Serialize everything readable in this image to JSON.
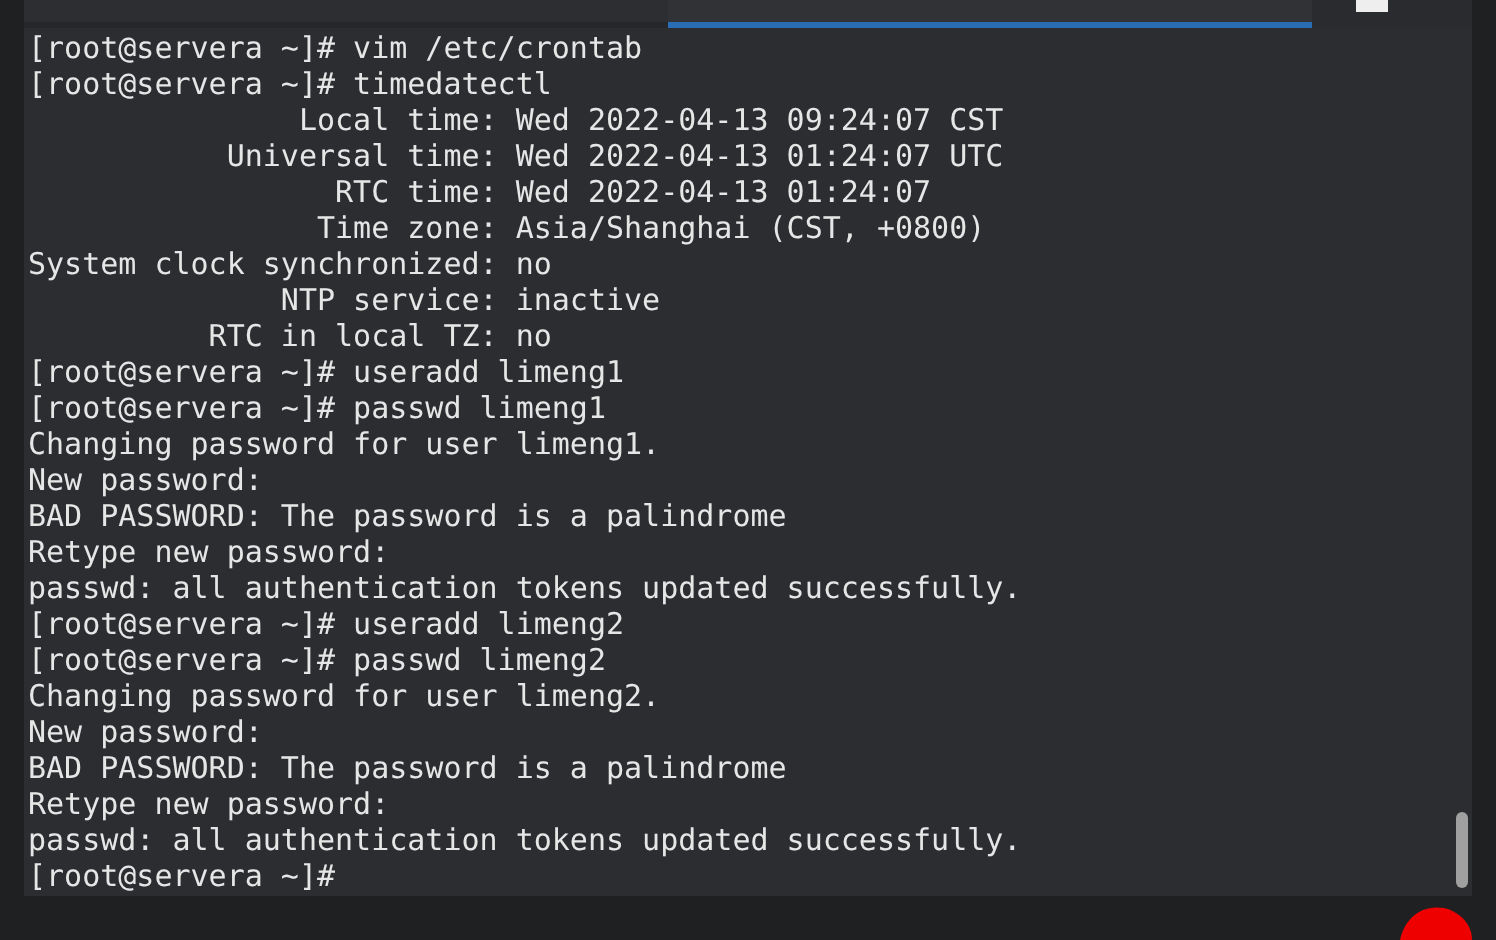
{
  "tabs": [
    {
      "selected": false
    },
    {
      "selected": true
    }
  ],
  "terminal": {
    "lines": [
      "[root@servera ~]# vim /etc/crontab",
      "[root@servera ~]# timedatectl",
      "               Local time: Wed 2022-04-13 09:24:07 CST",
      "           Universal time: Wed 2022-04-13 01:24:07 UTC",
      "                 RTC time: Wed 2022-04-13 01:24:07",
      "                Time zone: Asia/Shanghai (CST, +0800)",
      "System clock synchronized: no",
      "              NTP service: inactive",
      "          RTC in local TZ: no",
      "[root@servera ~]# useradd limeng1",
      "[root@servera ~]# passwd limeng1",
      "Changing password for user limeng1.",
      "New password:",
      "BAD PASSWORD: The password is a palindrome",
      "Retype new password:",
      "passwd: all authentication tokens updated successfully.",
      "[root@servera ~]# useradd limeng2",
      "[root@servera ~]# passwd limeng2",
      "Changing password for user limeng2.",
      "New password:",
      "BAD PASSWORD: The password is a palindrome",
      "Retype new password:",
      "passwd: all authentication tokens updated successfully.",
      "[root@servera ~]#"
    ]
  }
}
